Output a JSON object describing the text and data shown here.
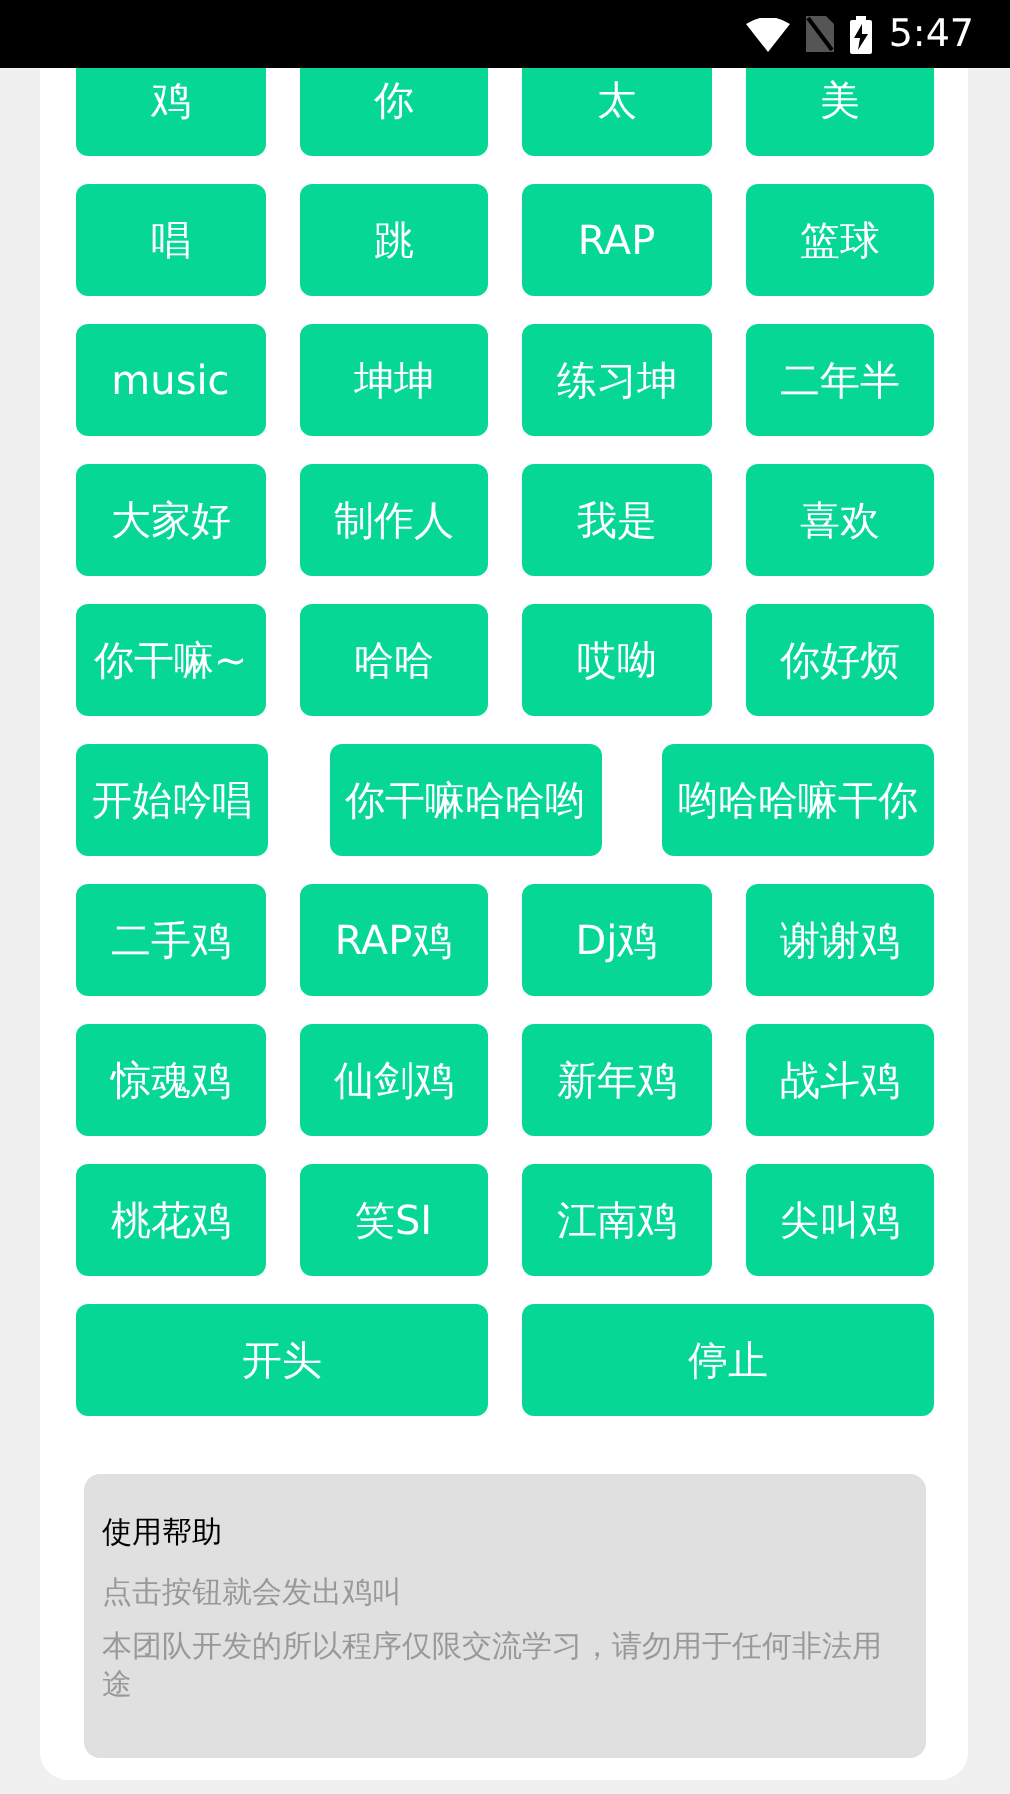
{
  "status_bar": {
    "time": "5:47"
  },
  "sound_buttons": [
    [
      "鸡",
      "你",
      "太",
      "美"
    ],
    [
      "唱",
      "跳",
      "RAP",
      "篮球"
    ],
    [
      "music",
      "坤坤",
      "练习坤",
      "二年半"
    ],
    [
      "大家好",
      "制作人",
      "我是",
      "喜欢"
    ],
    [
      "你干嘛~",
      "哈哈",
      "哎呦",
      "你好烦"
    ],
    [
      "开始吟唱",
      "你干嘛哈哈哟",
      "哟哈哈嘛干你"
    ],
    [
      "二手鸡",
      "RAP鸡",
      "Dj鸡",
      "谢谢鸡"
    ],
    [
      "惊魂鸡",
      "仙剑鸡",
      "新年鸡",
      "战斗鸡"
    ],
    [
      "桃花鸡",
      "笑SI",
      "江南鸡",
      "尖叫鸡"
    ]
  ],
  "controls": [
    "开头",
    "停止"
  ],
  "help": {
    "title": "使用帮助",
    "lines": [
      "点击按钮就会发出鸡叫",
      "本团队开发的所以程序仅限交流学习，请勿用于任何非法用途"
    ]
  }
}
